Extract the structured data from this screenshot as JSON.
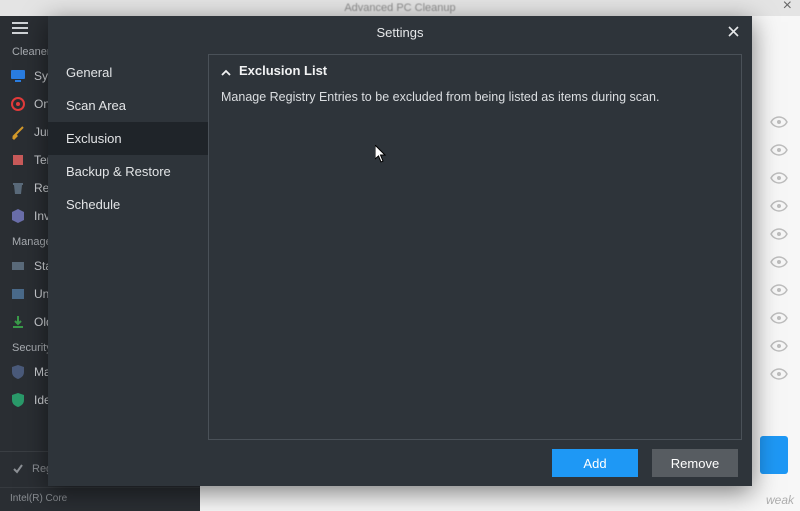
{
  "app": {
    "title": "Advanced PC Cleanup",
    "footer_label": "Register Now",
    "status_line": "Intel(R) Core",
    "watermark": "weak"
  },
  "bg_sidebar": {
    "categories": [
      {
        "label": "Cleaner",
        "items": [
          {
            "label": "Sys",
            "icon_color": "#2a7de1"
          },
          {
            "label": "One",
            "icon_color": "#e23b3b"
          },
          {
            "label": "Jun",
            "icon_color": "#d49a2a"
          },
          {
            "label": "Ten",
            "icon_color": "#c85a5a"
          },
          {
            "label": "Rec",
            "icon_color": "#5a6a7a"
          },
          {
            "label": "Inv",
            "icon_color": "#6a6eaa"
          }
        ]
      },
      {
        "label": "Manager",
        "items": [
          {
            "label": "Sta",
            "icon_color": "#5a6a7a"
          },
          {
            "label": "Uni",
            "icon_color": "#4a6a8a"
          },
          {
            "label": "Old",
            "icon_color": "#3a9a4a"
          }
        ]
      },
      {
        "label": "Security",
        "items": [
          {
            "label": "Ma",
            "icon_color": "#4a5a7a"
          },
          {
            "label": "Ide",
            "icon_color": "#2a9a6a"
          }
        ]
      }
    ]
  },
  "modal": {
    "title": "Settings",
    "nav": [
      {
        "id": "general",
        "label": "General"
      },
      {
        "id": "scan-area",
        "label": "Scan Area"
      },
      {
        "id": "exclusion",
        "label": "Exclusion",
        "selected": true
      },
      {
        "id": "backup-restore",
        "label": "Backup & Restore"
      },
      {
        "id": "schedule",
        "label": "Schedule"
      }
    ],
    "panel": {
      "heading": "Exclusion List",
      "description": "Manage Registry Entries to be excluded from being listed as items during scan."
    },
    "buttons": {
      "add": "Add",
      "remove": "Remove"
    }
  }
}
